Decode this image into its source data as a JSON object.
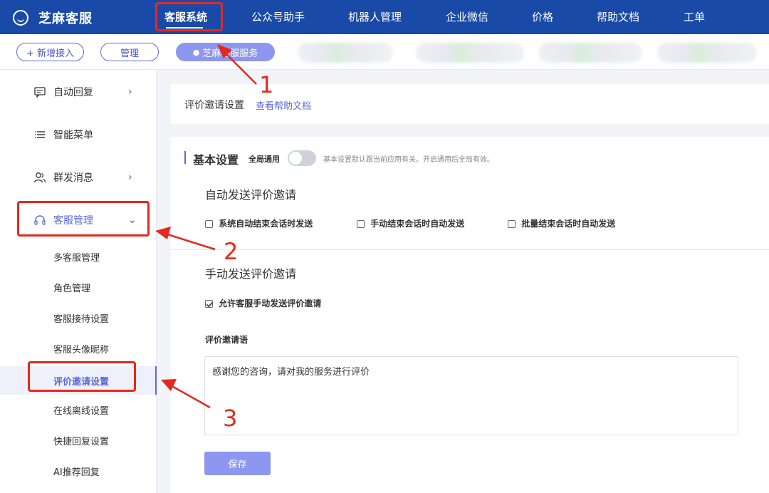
{
  "app": {
    "title": "芝麻客服"
  },
  "nav": {
    "items": [
      "客服系统",
      "公众号助手",
      "机器人管理",
      "企业微信",
      "价格",
      "帮助文档",
      "工单"
    ],
    "active": "客服系统"
  },
  "subbar": {
    "add_label": "+ 新增接入",
    "manage_label": "管理",
    "service_label": "芝麻客服服务"
  },
  "sidebar": {
    "items": [
      {
        "label": "自动回复",
        "icon": "chat-box-icon",
        "has_arrow": true
      },
      {
        "label": "智能菜单",
        "icon": "list-icon",
        "has_arrow": false
      },
      {
        "label": "群发消息",
        "icon": "users-icon",
        "has_arrow": true
      },
      {
        "label": "客服管理",
        "icon": "headset-icon",
        "expanded": true
      }
    ],
    "sub_items": [
      "多客服管理",
      "角色管理",
      "客服接待设置",
      "客服头像昵称",
      "评价邀请设置",
      "在线离线设置",
      "快捷回复设置",
      "AI推荐回复"
    ],
    "active_sub": "评价邀请设置"
  },
  "header": {
    "title": "评价邀请设置",
    "help_link": "查看帮助文档"
  },
  "basic": {
    "title": "基本设置",
    "global_label": "全局通用",
    "global_on": false,
    "hint": "基本设置默认跟当前应用有关。开启通用后全局有效。"
  },
  "auto_send": {
    "title": "自动发送评价邀请",
    "options": [
      {
        "label": "系统自动结束会话时发送",
        "checked": false
      },
      {
        "label": "手动结束会话时自动发送",
        "checked": false
      },
      {
        "label": "批量结束会话时自动发送",
        "checked": false
      }
    ]
  },
  "manual_send": {
    "title": "手动发送评价邀请",
    "allow_label": "允许客服手动发送评价邀请",
    "allow_checked": true
  },
  "invite": {
    "label": "评价邀请语",
    "text": "感谢您的咨询，请对我的服务进行评价"
  },
  "save_label": "保存",
  "annotations": {
    "n1": "1",
    "n2": "2",
    "n3": "3"
  },
  "colors": {
    "nav_bg": "#1a4aa7",
    "accent": "#5b6ad9",
    "annotation": "#e8271c"
  }
}
